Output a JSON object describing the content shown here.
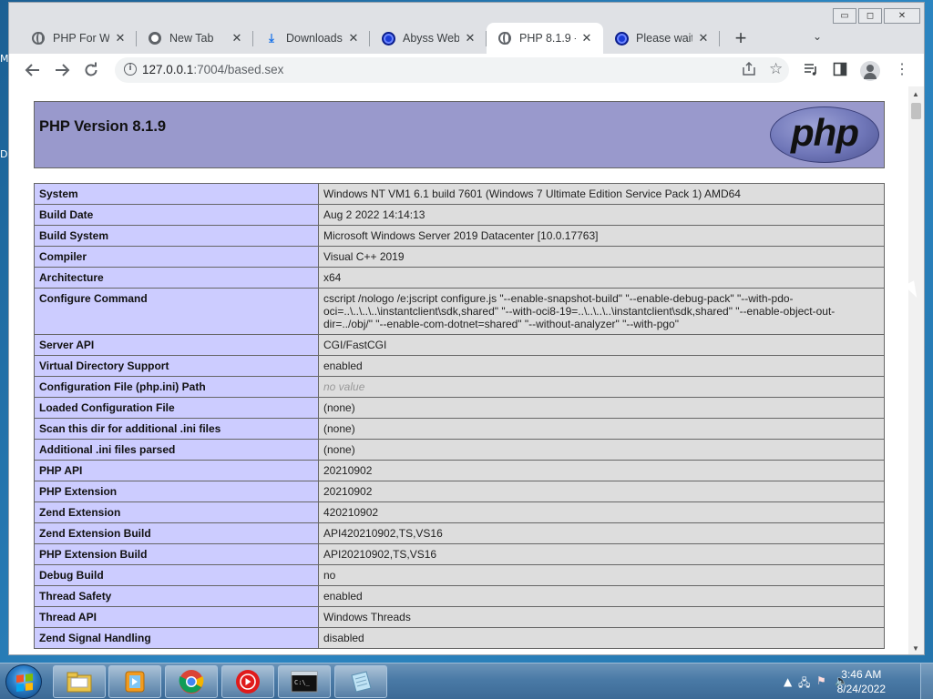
{
  "desktop": {
    "edge_letters": [
      "M",
      "D"
    ]
  },
  "window": {
    "controls": {
      "minimize": "▭",
      "restore": "◻",
      "close": "✕"
    }
  },
  "tabs": [
    {
      "title": "PHP For Wir",
      "icon": "globe-icon",
      "active": false
    },
    {
      "title": "New Tab",
      "icon": "chrome-icon",
      "active": false
    },
    {
      "title": "Downloads",
      "icon": "download-icon",
      "active": false
    },
    {
      "title": "Abyss Web",
      "icon": "abyss-icon",
      "active": false
    },
    {
      "title": "PHP 8.1.9 -",
      "icon": "globe-icon",
      "active": true
    },
    {
      "title": "Please wait",
      "icon": "abyss-icon",
      "active": false
    }
  ],
  "toolbar": {
    "url_host": "127.0.0.1",
    "url_path": ":7004/based.sex"
  },
  "phpinfo": {
    "version_title": "PHP Version 8.1.9",
    "logo_text": "php",
    "rows": [
      {
        "name": "System",
        "value": "Windows NT VM1 6.1 build 7601 (Windows 7 Ultimate Edition Service Pack 1) AMD64"
      },
      {
        "name": "Build Date",
        "value": "Aug 2 2022 14:14:13"
      },
      {
        "name": "Build System",
        "value": "Microsoft Windows Server 2019 Datacenter [10.0.17763]"
      },
      {
        "name": "Compiler",
        "value": "Visual C++ 2019"
      },
      {
        "name": "Architecture",
        "value": "x64"
      },
      {
        "name": "Configure Command",
        "value": "cscript /nologo /e:jscript configure.js \"--enable-snapshot-build\" \"--enable-debug-pack\" \"--with-pdo-oci=..\\..\\..\\..\\instantclient\\sdk,shared\" \"--with-oci8-19=..\\..\\..\\..\\instantclient\\sdk,shared\" \"--enable-object-out-dir=../obj/\" \"--enable-com-dotnet=shared\" \"--without-analyzer\" \"--with-pgo\""
      },
      {
        "name": "Server API",
        "value": "CGI/FastCGI"
      },
      {
        "name": "Virtual Directory Support",
        "value": "enabled"
      },
      {
        "name": "Configuration File (php.ini) Path",
        "value": "no value",
        "novalue": true
      },
      {
        "name": "Loaded Configuration File",
        "value": "(none)"
      },
      {
        "name": "Scan this dir for additional .ini files",
        "value": "(none)"
      },
      {
        "name": "Additional .ini files parsed",
        "value": "(none)"
      },
      {
        "name": "PHP API",
        "value": "20210902"
      },
      {
        "name": "PHP Extension",
        "value": "20210902"
      },
      {
        "name": "Zend Extension",
        "value": "420210902"
      },
      {
        "name": "Zend Extension Build",
        "value": "API420210902,TS,VS16"
      },
      {
        "name": "PHP Extension Build",
        "value": "API20210902,TS,VS16"
      },
      {
        "name": "Debug Build",
        "value": "no"
      },
      {
        "name": "Thread Safety",
        "value": "enabled"
      },
      {
        "name": "Thread API",
        "value": "Windows Threads"
      },
      {
        "name": "Zend Signal Handling",
        "value": "disabled"
      }
    ]
  },
  "taskbar": {
    "buttons": [
      "file-explorer-icon",
      "media-player-icon",
      "chrome-icon",
      "youtube-music-icon",
      "command-prompt-icon",
      "notepad-icon"
    ],
    "clock_time": "3:46 AM",
    "clock_date": "8/24/2022"
  },
  "colors": {
    "php_header": "#9999cc",
    "key_cell": "#ccccff",
    "value_cell": "#dddddd"
  }
}
